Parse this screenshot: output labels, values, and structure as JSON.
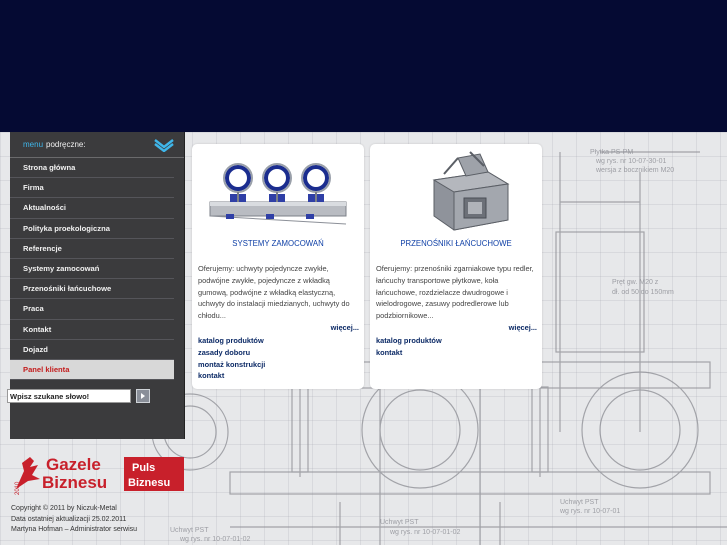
{
  "menu": {
    "title_word1": "menu",
    "title_word2": "podręczne:",
    "items": [
      {
        "label": "Strona główna"
      },
      {
        "label": "Firma"
      },
      {
        "label": "Aktualności"
      },
      {
        "label": "Polityka proekologiczna"
      },
      {
        "label": "Referencje"
      },
      {
        "label": "Systemy zamocowań"
      },
      {
        "label": "Przenośniki łańcuchowe"
      },
      {
        "label": "Praca"
      },
      {
        "label": "Kontakt"
      },
      {
        "label": "Dojazd"
      },
      {
        "label": "Panel klienta"
      }
    ]
  },
  "search": {
    "value": "Wpisz szukane słowo!"
  },
  "cards": [
    {
      "title": "SYSTEMY ZAMOCOWAŃ",
      "desc": "Oferujemy: uchwyty pojedyncze zwykłe, podwójne zwykłe, pojedyncze z wkładką gumową, podwójne z wkładką elastyczną, uchwyty do instalacji miedzianych, uchwyty do chłodu...",
      "more": "więcej...",
      "links": [
        "katalog produktów",
        "zasady doboru",
        "montaż konstrukcji",
        "kontakt"
      ]
    },
    {
      "title": "PRZENOŚNIKI ŁAŃCUCHOWE",
      "desc": "Oferujemy: przenośniki zgarniakowe typu redler, łańcuchy transportowe płytkowe, koła łańcuchowe, rozdzielacze dwudrogowe i wielodrogowe, zasuwy podredlerowe lub podzbiornikowe...",
      "more": "więcej...",
      "links": [
        "katalog produktów",
        "kontakt"
      ]
    }
  ],
  "logo": {
    "year": "2010",
    "line1": "Gazele",
    "line2": "Biznesu",
    "brand1": "Puls",
    "brand2": "Biznesu"
  },
  "footer": {
    "line1": "Copyright © 2011 by Niczuk-Metal",
    "line2": "Data ostatniej aktualizacji 25.02.2011",
    "line3": "Martyna Hofman – Administrator serwisu"
  },
  "colors": {
    "header": "#050a33",
    "sidebar": "#3b3b3d",
    "accent_blue": "#3fb6ea",
    "link_blue": "#0c2a66",
    "active_red": "#c31c1c",
    "logo_red": "#c8202b"
  }
}
